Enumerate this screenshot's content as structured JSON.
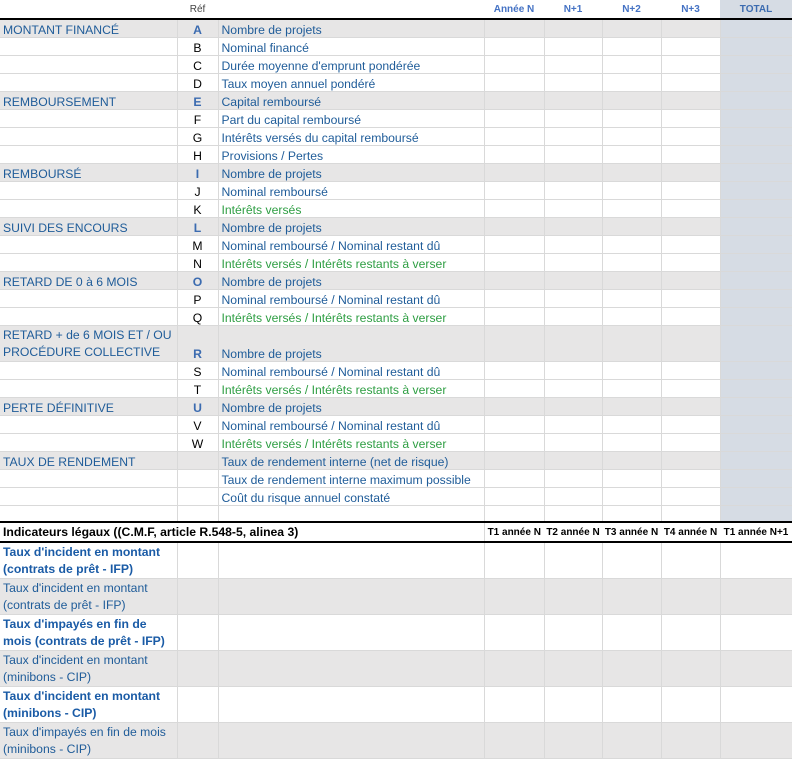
{
  "header": {
    "ref": "Réf",
    "cols": [
      "Année N",
      "N+1",
      "N+2",
      "N+3",
      "TOTAL"
    ]
  },
  "rows": [
    {
      "section": "MONTANT FINANCÉ",
      "ref": "A",
      "metric": "Nombre de projets",
      "refBold": true,
      "green": false
    },
    {
      "section": "",
      "ref": "B",
      "metric": "Nominal financé",
      "refBold": false,
      "green": false
    },
    {
      "section": "",
      "ref": "C",
      "metric": "Durée moyenne d'emprunt pondérée",
      "refBold": false,
      "green": false
    },
    {
      "section": "",
      "ref": "D",
      "metric": "Taux moyen annuel pondéré",
      "refBold": false,
      "green": false
    },
    {
      "section": "REMBOURSEMENT",
      "ref": "E",
      "metric": "Capital remboursé",
      "refBold": true,
      "green": false
    },
    {
      "section": "",
      "ref": "F",
      "metric": "Part du capital remboursé",
      "refBold": false,
      "green": false
    },
    {
      "section": "",
      "ref": "G",
      "metric": "Intérêts versés du capital remboursé",
      "refBold": false,
      "green": false
    },
    {
      "section": "",
      "ref": "H",
      "metric": "Provisions / Pertes",
      "refBold": false,
      "green": false
    },
    {
      "section": "REMBOURSÉ",
      "ref": "I",
      "metric": "Nombre de projets",
      "refBold": true,
      "green": false
    },
    {
      "section": "",
      "ref": "J",
      "metric": "Nominal remboursé",
      "refBold": false,
      "green": false
    },
    {
      "section": "",
      "ref": "K",
      "metric": "Intérêts versés",
      "refBold": false,
      "green": true
    },
    {
      "section": "SUIVI DES ENCOURS",
      "ref": "L",
      "metric": "Nombre de projets",
      "refBold": true,
      "green": false
    },
    {
      "section": "",
      "ref": "M",
      "metric": "Nominal remboursé / Nominal restant dû",
      "refBold": false,
      "green": false
    },
    {
      "section": "",
      "ref": "N",
      "metric": "Intérêts versés / Intérêts restants à verser",
      "refBold": false,
      "green": true
    },
    {
      "section": "RETARD DE 0 à 6 MOIS",
      "ref": "O",
      "metric": "Nombre de projets",
      "refBold": true,
      "green": false
    },
    {
      "section": "",
      "ref": "P",
      "metric": "Nominal remboursé / Nominal restant dû",
      "refBold": false,
      "green": false
    },
    {
      "section": "",
      "ref": "Q",
      "metric": "Intérêts versés / Intérêts restants à verser",
      "refBold": false,
      "green": true
    },
    {
      "section": "RETARD + de 6 MOIS ET / OU PROCÉDURE COLLECTIVE",
      "ref": "R",
      "metric": "Nombre de projets",
      "refBold": true,
      "green": false,
      "tall": true
    },
    {
      "section": "",
      "ref": "S",
      "metric": "Nominal remboursé / Nominal restant dû",
      "refBold": false,
      "green": false
    },
    {
      "section": "",
      "ref": "T",
      "metric": "Intérêts versés / Intérêts restants à verser",
      "refBold": false,
      "green": true
    },
    {
      "section": "PERTE DÉFINITIVE",
      "ref": "U",
      "metric": "Nombre de projets",
      "refBold": true,
      "green": false
    },
    {
      "section": "",
      "ref": "V",
      "metric": "Nominal remboursé / Nominal restant dû",
      "refBold": false,
      "green": false
    },
    {
      "section": "",
      "ref": "W",
      "metric": "Intérêts versés / Intérêts restants à verser",
      "refBold": false,
      "green": true
    },
    {
      "section": "TAUX DE RENDEMENT",
      "ref": "",
      "metric": "Taux de rendement interne (net de risque)",
      "refBold": false,
      "green": false
    },
    {
      "section": "",
      "ref": "",
      "metric": "Taux de rendement interne maximum possible",
      "refBold": false,
      "green": false
    },
    {
      "section": "",
      "ref": "",
      "metric": "Coût du risque annuel constaté",
      "refBold": false,
      "green": false
    }
  ],
  "legal": {
    "title": "Indicateurs légaux ((C.M.F, article R.548-5, alinea 3)",
    "cols": [
      "T1 année N",
      "T2 année N",
      "T3 année N",
      "T4 année N",
      "T1 année N+1"
    ],
    "rows": [
      {
        "label": "Taux d'incident en montant (contrats de prêt - IFP)",
        "bold": true
      },
      {
        "label": "Taux d'incident en montant (contrats de prêt - IFP)",
        "bold": false
      },
      {
        "label": "Taux d'impayés en fin de mois (contrats de prêt - IFP)",
        "bold": true
      },
      {
        "label": "Taux d'incident en montant (minibons - CIP)",
        "bold": false
      },
      {
        "label": "Taux d'incident en montant (minibons - CIP)",
        "bold": true
      },
      {
        "label": "Taux d'impayés en fin de mois (minibons - CIP)",
        "bold": false
      }
    ]
  }
}
